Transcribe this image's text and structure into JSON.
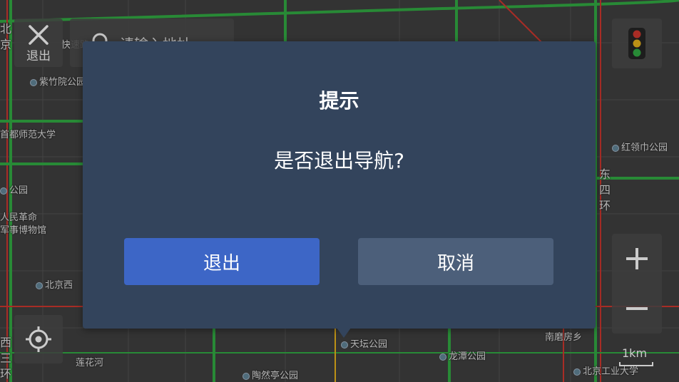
{
  "map": {
    "labels": [
      {
        "text": "紫竹院公园",
        "poi": true
      },
      {
        "text": "首都师范大学",
        "poi": false
      },
      {
        "text": "公园",
        "poi": true
      },
      {
        "text": "人民革命",
        "poi": false
      },
      {
        "text": "军事博物馆",
        "poi": false
      },
      {
        "text": "北京西",
        "poi": true
      },
      {
        "text": "莲花河",
        "poi": false
      },
      {
        "text": "陶然亭公园",
        "poi": true
      },
      {
        "text": "天坛公园",
        "poi": true
      },
      {
        "text": "龙潭公园",
        "poi": true
      },
      {
        "text": "南磨房乡",
        "poi": false
      },
      {
        "text": "北京工业大学",
        "poi": true
      },
      {
        "text": "红领巾公园",
        "poi": true
      },
      {
        "text": "东四环",
        "poi": false
      },
      {
        "text": "西三环",
        "poi": false
      },
      {
        "text": "北京",
        "poi": false
      },
      {
        "text": "快速路",
        "poi": false
      }
    ]
  },
  "controls": {
    "exit_label": "退出",
    "search_placeholder": "请输入地址",
    "scale_label": "1km"
  },
  "dialog": {
    "title": "提示",
    "message": "是否退出导航?",
    "confirm_label": "退出",
    "cancel_label": "取消"
  },
  "colors": {
    "dialog_bg": "#33445c",
    "confirm_bg": "#3d66c6",
    "cancel_bg": "#4c5f7a",
    "traffic_green": "#2e9e3e",
    "traffic_red": "#c0332b",
    "traffic_yellow": "#d6a51a"
  }
}
